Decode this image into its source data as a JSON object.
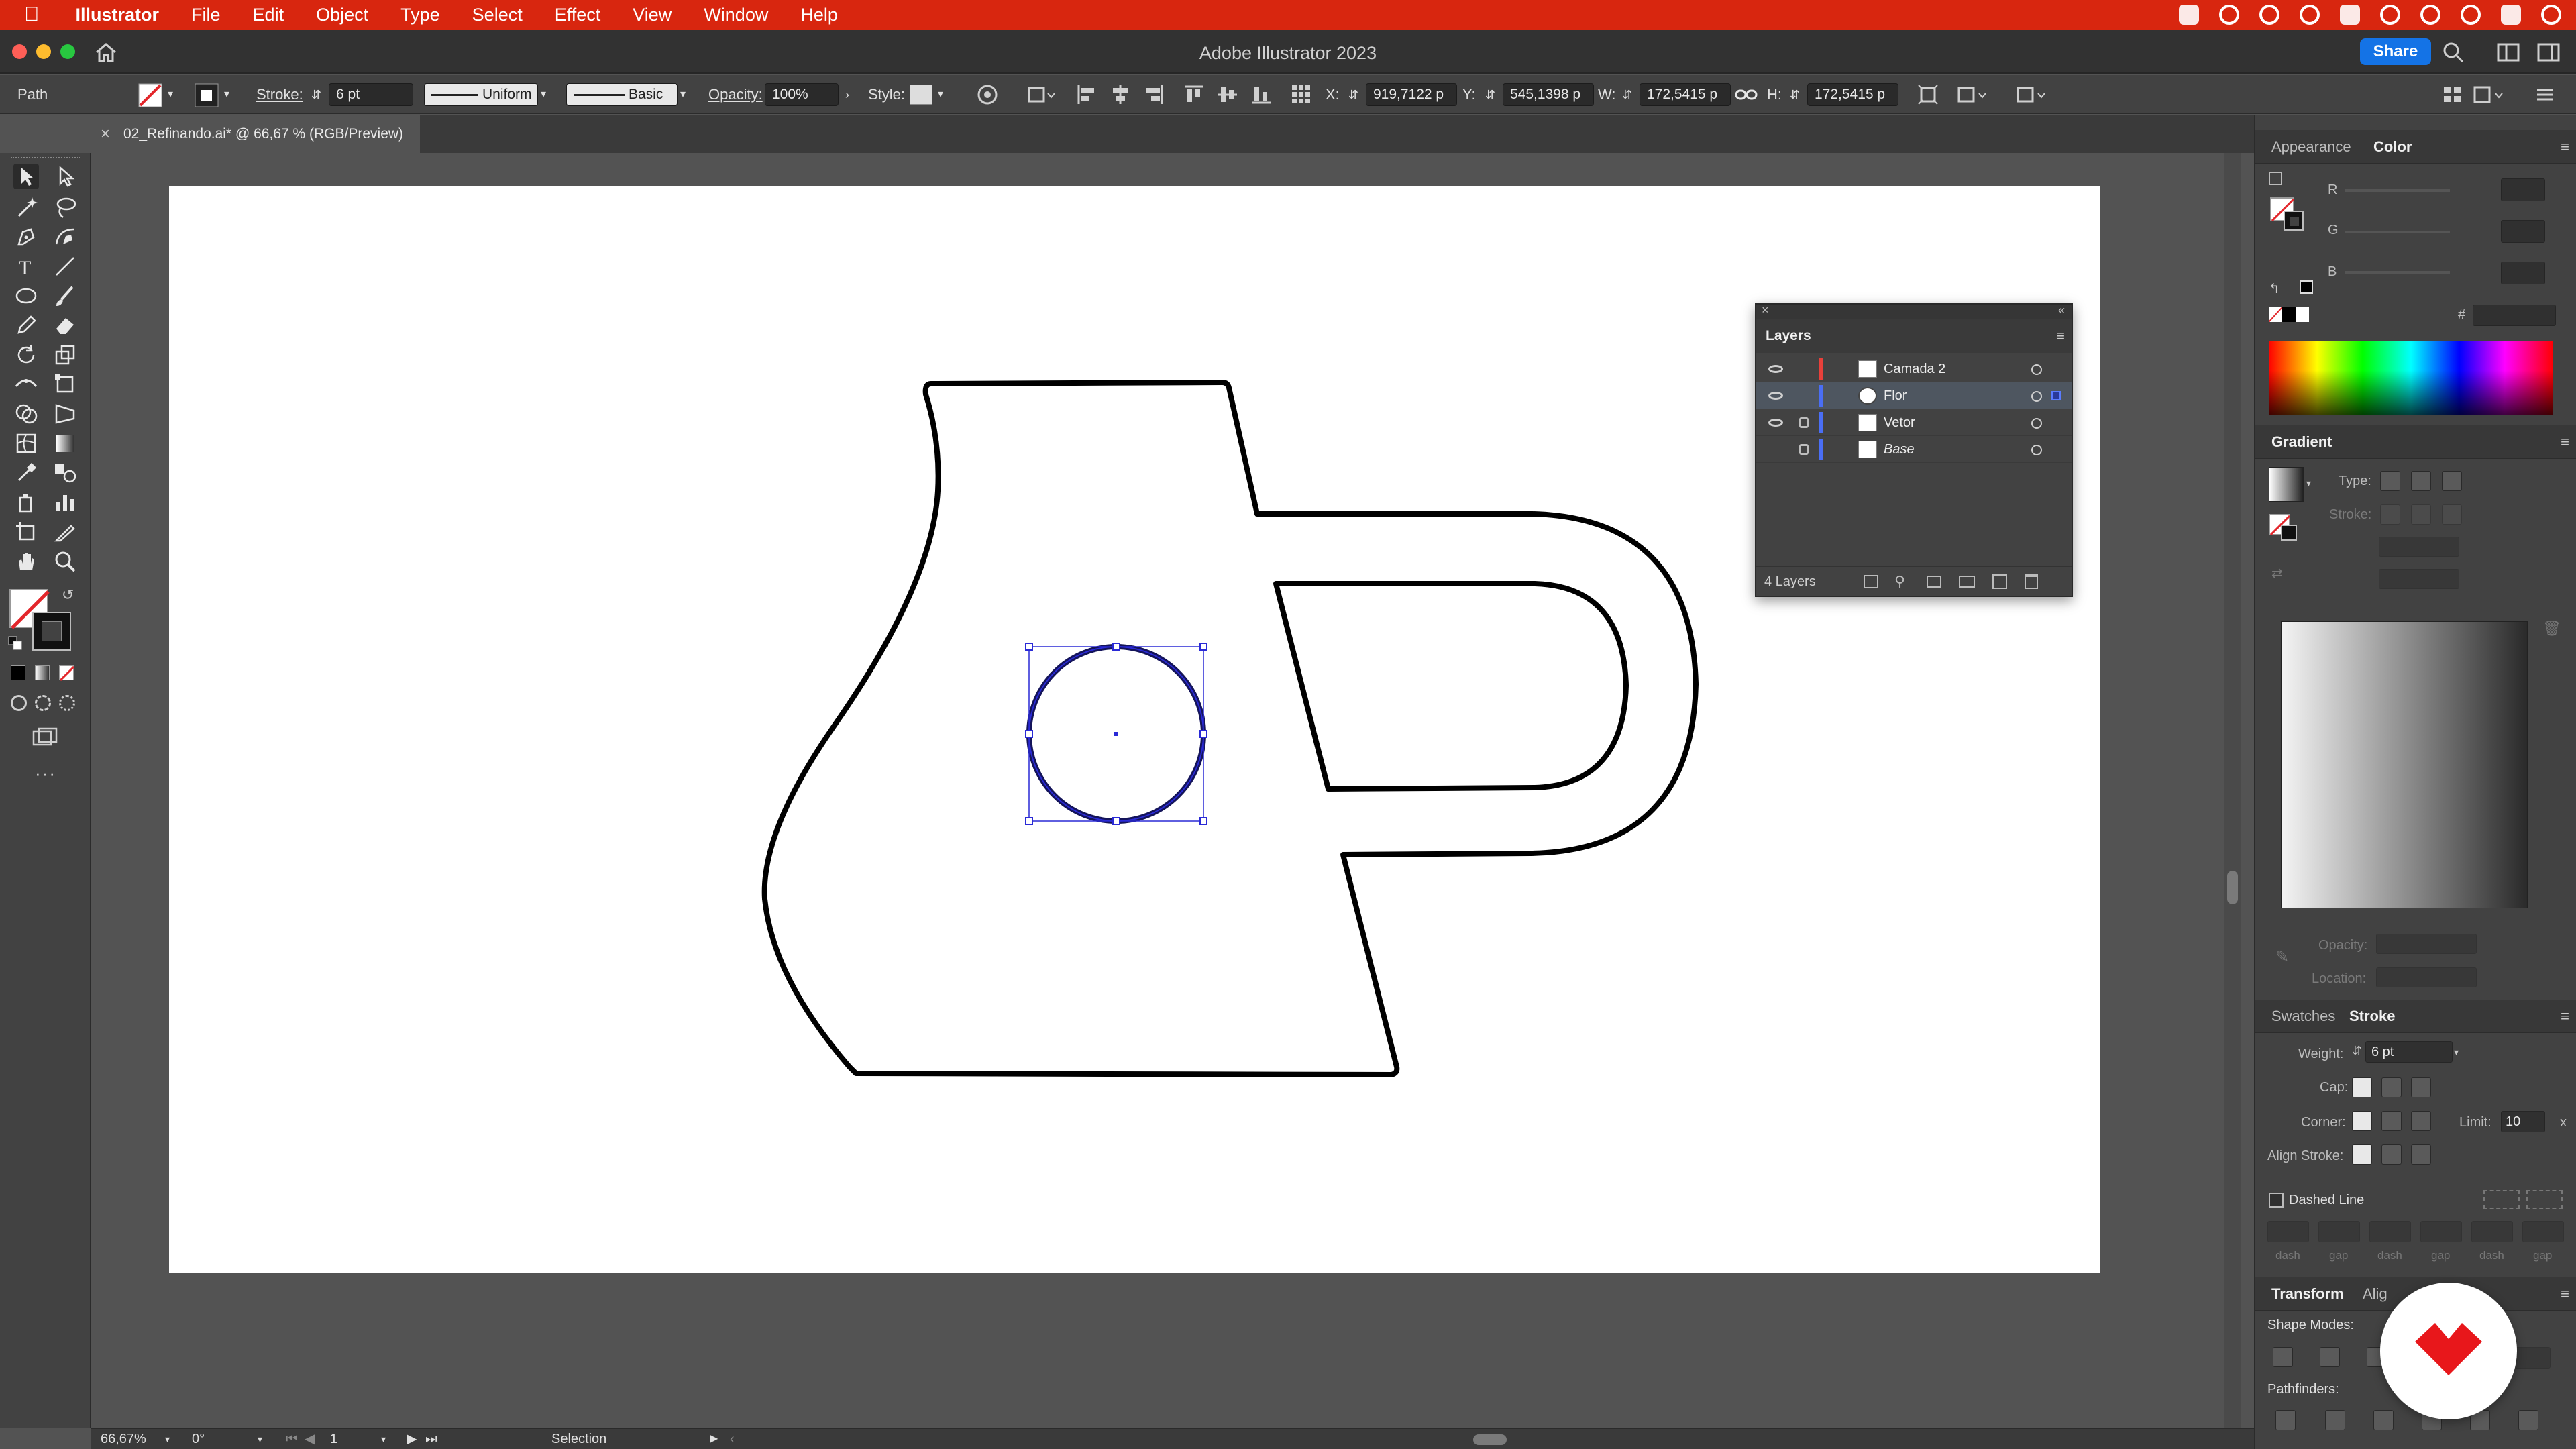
{
  "menubar": {
    "app_name": "Illustrator",
    "items": [
      "File",
      "Edit",
      "Object",
      "Type",
      "Select",
      "Effect",
      "View",
      "Window",
      "Help"
    ]
  },
  "window": {
    "title": "Adobe Illustrator 2023",
    "share_label": "Share"
  },
  "controlbar": {
    "selection_type": "Path",
    "stroke_label": "Stroke:",
    "stroke_weight": "6 pt",
    "profile": "Uniform",
    "brush": "Basic",
    "opacity_label": "Opacity:",
    "opacity": "100%",
    "style_label": "Style:",
    "x_label": "X:",
    "x_value": "919,7122 p",
    "y_label": "Y:",
    "y_value": "545,1398 p",
    "w_label": "W:",
    "w_value": "172,5415 p",
    "h_label": "H:",
    "h_value": "172,5415 p"
  },
  "document": {
    "tab_title": "02_Refinando.ai* @ 66,67 % (RGB/Preview)",
    "close": "×"
  },
  "layers": {
    "title": "Layers",
    "rows": [
      {
        "name": "Camada 2",
        "color": "#e8403a",
        "visible": true,
        "locked": false,
        "selected": false,
        "italic": false
      },
      {
        "name": "Flor",
        "color": "#4a6ef5",
        "visible": true,
        "locked": false,
        "selected": true,
        "italic": false
      },
      {
        "name": "Vetor",
        "color": "#4a6ef5",
        "visible": true,
        "locked": true,
        "selected": false,
        "italic": false
      },
      {
        "name": "Base",
        "color": "#4a6ef5",
        "visible": false,
        "locked": true,
        "selected": false,
        "italic": true
      }
    ],
    "count": "4 Layers"
  },
  "right_panels": {
    "appearance_tab": "Appearance",
    "color_tab": "Color",
    "color_channels": [
      "R",
      "G",
      "B"
    ],
    "hex_symbol": "#",
    "gradient_title": "Gradient",
    "gradient_type_label": "Type:",
    "gradient_stroke_label": "Stroke:",
    "gradient_opacity_label": "Opacity:",
    "gradient_location_label": "Location:",
    "swatches_tab": "Swatches",
    "stroke_tab": "Stroke",
    "weight_label": "Weight:",
    "weight_value": "6 pt",
    "cap_label": "Cap:",
    "corner_label": "Corner:",
    "limit_label": "Limit:",
    "limit_value": "10",
    "limit_x": "x",
    "align_stroke_label": "Align Stroke:",
    "dashed_line_label": "Dashed Line",
    "dash_labels": [
      "dash",
      "gap",
      "dash",
      "gap",
      "dash",
      "gap"
    ],
    "transform_tab": "Transform",
    "align_tab": "Alig",
    "shape_modes_label": "Shape Modes:",
    "pathfinders_label": "Pathfinders:"
  },
  "statusbar": {
    "zoom": "66,67%",
    "rotation": "0°",
    "artboard": "1",
    "tool": "Selection"
  },
  "colors": {
    "accent": "#1473e6",
    "menubar": "#d8260f",
    "selection": "#2a2ad6",
    "brand": "#e8171b"
  }
}
